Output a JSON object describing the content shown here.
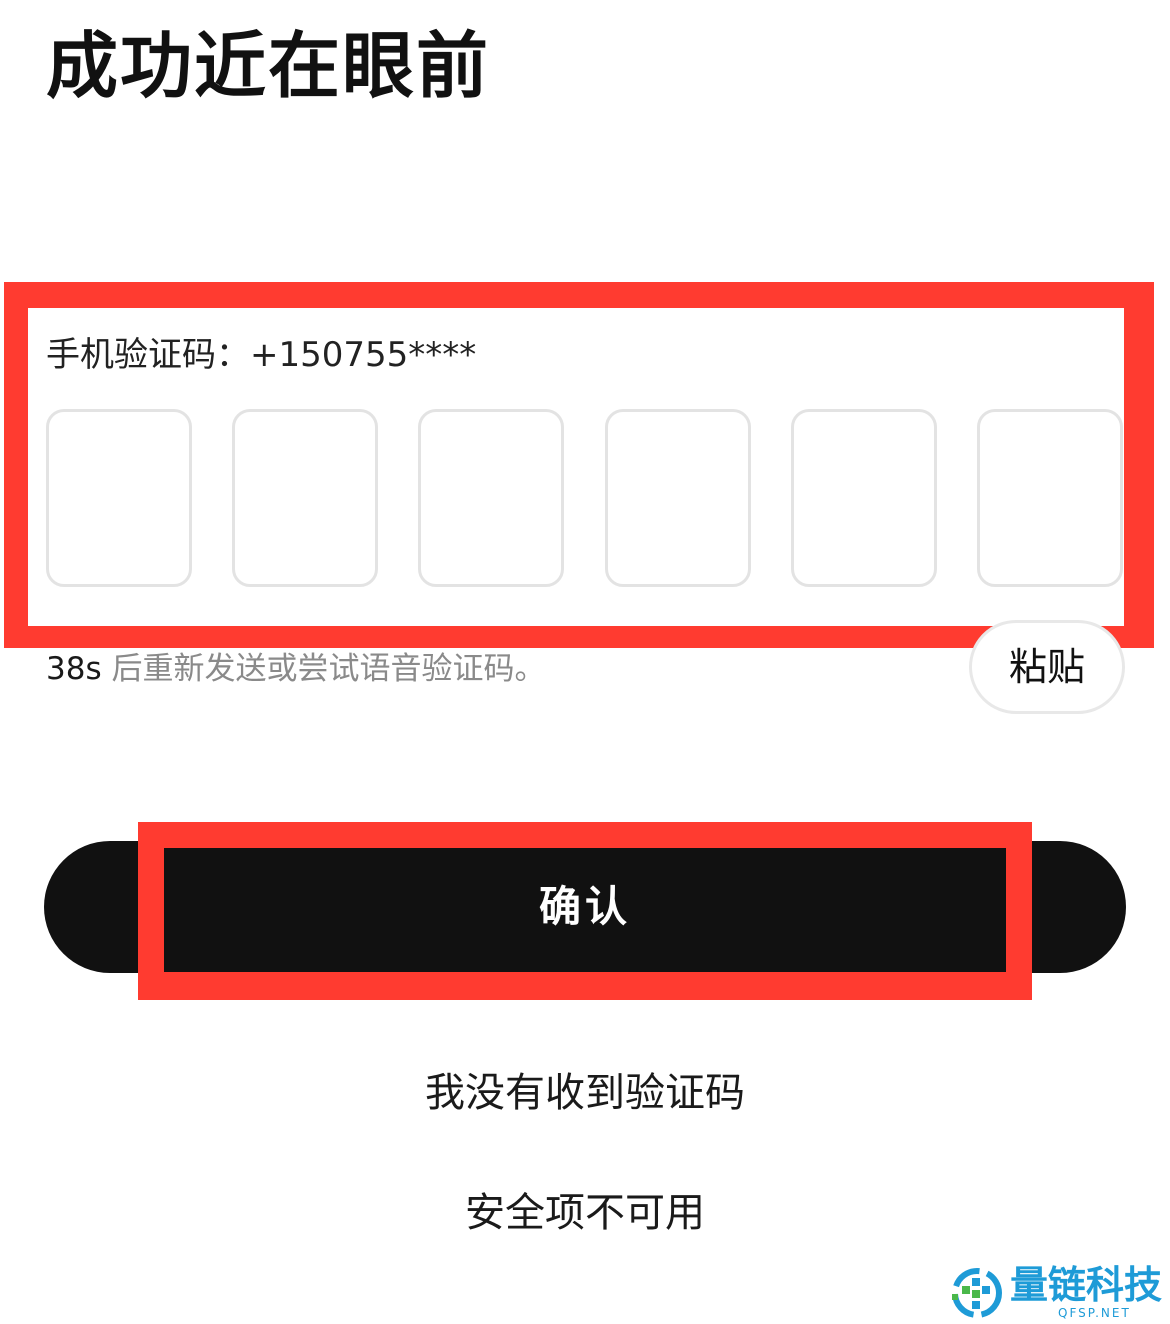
{
  "header": {
    "title": "成功近在眼前"
  },
  "otp": {
    "label": "手机验证码：+150755****",
    "digits": [
      "",
      "",
      "",
      "",
      "",
      ""
    ]
  },
  "resend": {
    "countdown": "38s",
    "message": " 后重新发送或尝试语音验证码。"
  },
  "paste_button": {
    "label": "粘贴"
  },
  "confirm_button": {
    "label": "确认"
  },
  "links": {
    "no_code": "我没有收到验证码",
    "security_unavailable": "安全项不可用"
  },
  "watermark": {
    "text": "量链科技",
    "sub": "QFSP.NET"
  },
  "colors": {
    "highlight": "#ff3b30",
    "button_bg": "#111111",
    "watermark": "#1e9bd7"
  }
}
